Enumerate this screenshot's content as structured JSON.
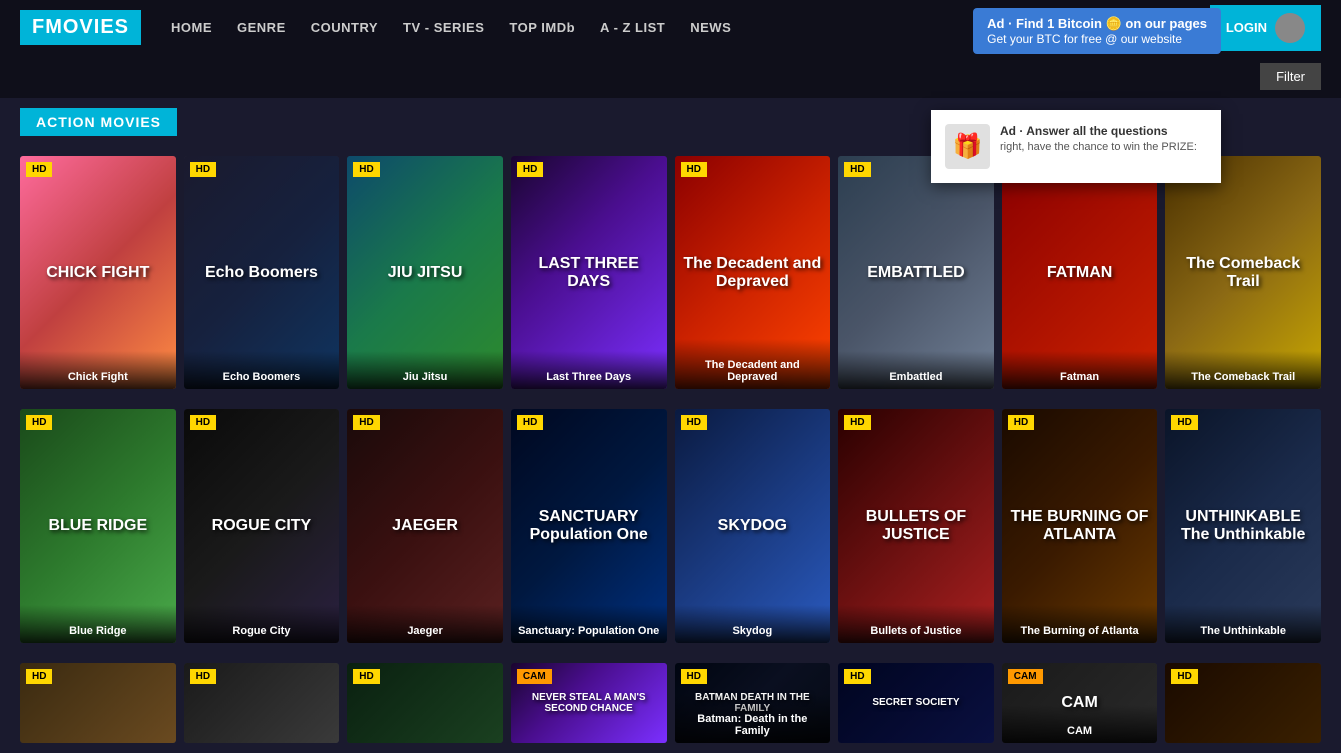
{
  "header": {
    "logo": "FMOVIES",
    "nav": [
      {
        "label": "HOME",
        "id": "home"
      },
      {
        "label": "GENRE",
        "id": "genre"
      },
      {
        "label": "COUNTRY",
        "id": "country"
      },
      {
        "label": "TV - SERIES",
        "id": "tv-series"
      },
      {
        "label": "TOP IMDb",
        "id": "top-imdb"
      },
      {
        "label": "A - Z LIST",
        "id": "a-z-list"
      },
      {
        "label": "NEWS",
        "id": "news"
      }
    ],
    "login_label": "LOGIN"
  },
  "ad_bitcoin": {
    "title": "Ad · Find 1 Bitcoin 🪙 on our pages",
    "subtitle": "Get your BTC for free @ our website"
  },
  "ad_quiz": {
    "title": "Ad · Answer all the questions",
    "subtitle": "right, have the chance to win the PRIZE:"
  },
  "filter": {
    "label": "Filter"
  },
  "section": {
    "title": "ACTION MOVIES"
  },
  "rows": [
    {
      "movies": [
        {
          "title": "Chick Fight",
          "quality": "HD",
          "poster_class": "poster-chickfight",
          "text": "CHICK FIGHT"
        },
        {
          "title": "Echo Boomers",
          "quality": "HD",
          "poster_class": "poster-echo",
          "text": "Echo Boomers"
        },
        {
          "title": "Jiu Jitsu",
          "quality": "HD",
          "poster_class": "poster-jiujitsu",
          "text": "JIU JITSU"
        },
        {
          "title": "Last Three Days",
          "quality": "HD",
          "poster_class": "poster-lastthree",
          "text": "LAST THREE DAYS"
        },
        {
          "title": "The Decadent and Depraved",
          "quality": "HD",
          "poster_class": "poster-decadent",
          "text": "The Decadent and Depraved"
        },
        {
          "title": "Embattled",
          "quality": "HD",
          "poster_class": "poster-embattled",
          "text": "EMBATTLED"
        },
        {
          "title": "Fatman",
          "quality": "HD",
          "poster_class": "poster-fatman",
          "text": "FATMAN"
        },
        {
          "title": "The Comeback Trail",
          "quality": "HD",
          "poster_class": "poster-comeback",
          "text": "The Comeback Trail"
        }
      ]
    },
    {
      "movies": [
        {
          "title": "Blue Ridge",
          "quality": "HD",
          "poster_class": "poster-blueridge",
          "text": "BLUE RIDGE"
        },
        {
          "title": "Rogue City",
          "quality": "HD",
          "poster_class": "poster-roguecity",
          "text": "ROGUE CITY"
        },
        {
          "title": "Jaeger",
          "quality": "HD",
          "poster_class": "poster-jaeger",
          "text": "JAEGER"
        },
        {
          "title": "Sanctuary: Population One",
          "quality": "HD",
          "poster_class": "poster-sanctuary",
          "text": "SANCTUARY Population One"
        },
        {
          "title": "Skydog",
          "quality": "HD",
          "poster_class": "poster-skydog",
          "text": "SKYDOG"
        },
        {
          "title": "Bullets of Justice",
          "quality": "HD",
          "poster_class": "poster-bullets",
          "text": "BULLETS OF JUSTICE"
        },
        {
          "title": "The Burning of Atlanta",
          "quality": "HD",
          "poster_class": "poster-burning",
          "text": "THE BURNING OF ATLANTA"
        },
        {
          "title": "The Unthinkable",
          "quality": "HD",
          "poster_class": "poster-unthinkable",
          "text": "UNTHINKABLE The Unthinkable"
        }
      ]
    },
    {
      "movies": [
        {
          "title": "",
          "quality": "HD",
          "poster_class": "poster-row3a",
          "text": ""
        },
        {
          "title": "",
          "quality": "HD",
          "poster_class": "poster-row3b",
          "text": ""
        },
        {
          "title": "",
          "quality": "HD",
          "poster_class": "poster-row3c",
          "text": ""
        },
        {
          "title": "",
          "quality": "CAM",
          "poster_class": "poster-lastthree",
          "text": "NEVER STEAL A MAN'S..."
        },
        {
          "title": "Batman: Death in the Family",
          "quality": "HD",
          "poster_class": "poster-batman",
          "text": "BATMAN DEATH IN THE FAMILY"
        },
        {
          "title": "Secret Society",
          "quality": "HD",
          "poster_class": "poster-secret",
          "text": "SECRET SOCIETY"
        },
        {
          "title": "CAM",
          "quality": "CAM",
          "poster_class": "poster-row3f",
          "text": "CAM"
        },
        {
          "title": "",
          "quality": "HD",
          "poster_class": "poster-row3g",
          "text": ""
        }
      ]
    }
  ]
}
